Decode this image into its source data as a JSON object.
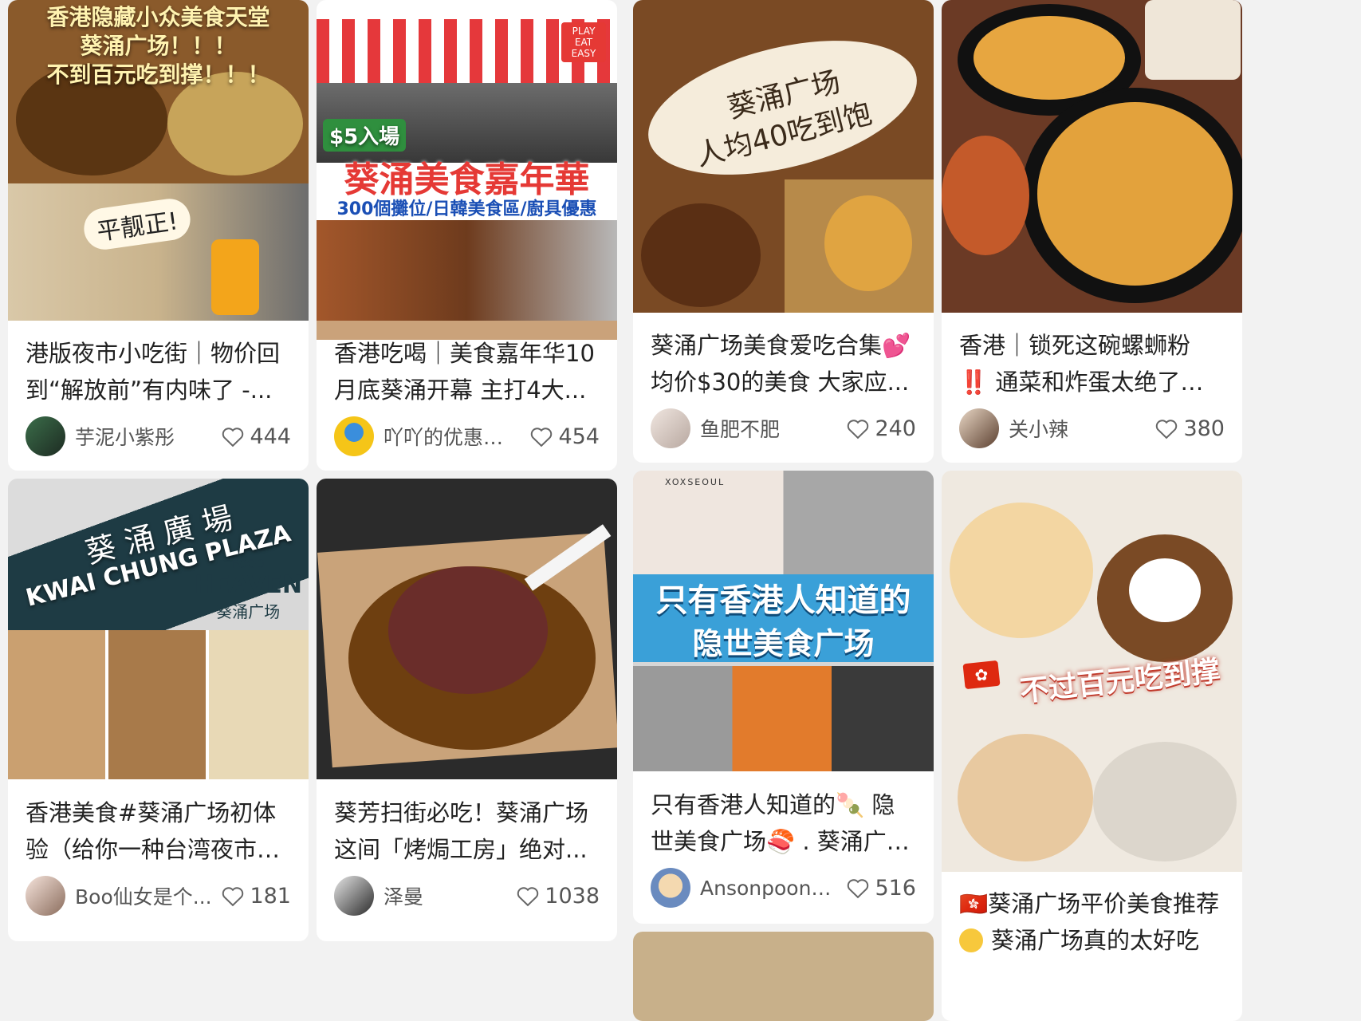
{
  "feed": {
    "cards": [
      {
        "overlay_lines": [
          "香港隐藏小众美食天堂",
          "葵涌广场！！！",
          "不到百元吃到撑！！！",
          "平靓正!"
        ],
        "title": "港版夜市小吃街｜物价回到“解放前”有内味了 -...",
        "author": "芋泥小紫彤",
        "likes": "444"
      },
      {
        "overlay_lines": [
          "$5入場",
          "葵涌美食嘉年華",
          "300個攤位/日韓美食區/廚具優惠",
          "PLAY EAT EASY"
        ],
        "title": "香港吃喝｜美食嘉年华10月底葵涌开幕 主打4大...",
        "author": "吖吖的优惠角度",
        "likes": "454"
      },
      {
        "overlay_lines": [
          "葵涌广场",
          "人均40吃到饱"
        ],
        "title": "葵涌广场美食爱吃合集💕 均价$30的美食 大家应...",
        "author": "鱼肥不肥",
        "likes": "240"
      },
      {
        "overlay_lines": [],
        "title": "香港｜锁死这碗螺蛳粉 ‼️ 通菜和炸蛋太绝了🆘 最...",
        "author": "关小辣",
        "likes": "380"
      },
      {
        "overlay_lines": [
          "葵 涌 廣 場",
          "KWAI CHUNG PLAZA",
          "FOOD",
          "HEAVEN",
          "葵涌广场"
        ],
        "title": "香港美食#葵涌广场初体验（给你一种台湾夜市的...",
        "author": "Boo仙女是个...",
        "likes": "181"
      },
      {
        "overlay_lines": [],
        "title": "葵芳扫街必吃！葵涌广场这间「烤焗工房」绝对...",
        "author": "泽曼",
        "likes": "1038"
      },
      {
        "overlay_lines": [
          "XOXSEOUL",
          "只有香港人知道的",
          "隐世美食广场"
        ],
        "title": "只有香港人知道的🍡 隐世美食广场🍣 . 葵涌广场...",
        "author": "Ansonpoon999",
        "likes": "516"
      },
      {
        "overlay_lines": [
          "不过百元吃到撑"
        ],
        "title": "🇭🇰葵涌广场平价美食推荐",
        "subtitle": "葵涌广场真的太好吃",
        "author": "",
        "likes": ""
      }
    ]
  }
}
